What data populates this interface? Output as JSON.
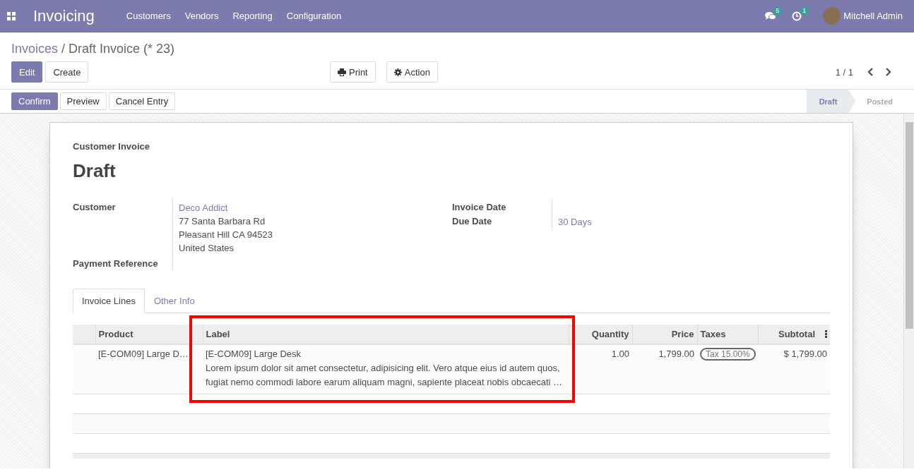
{
  "navbar": {
    "app_name": "Invoicing",
    "menu": [
      "Customers",
      "Vendors",
      "Reporting",
      "Configuration"
    ],
    "messages_count": "5",
    "activities_count": "1",
    "user": "Mitchell Admin"
  },
  "breadcrumb": {
    "parent": "Invoices",
    "separator": "/",
    "current": "Draft Invoice (* 23)"
  },
  "buttons": [
    {
      "label": "Edit",
      "primary": true
    },
    {
      "label": "Create",
      "primary": false
    }
  ],
  "actions": [
    {
      "label": "Print",
      "kind": "print"
    },
    {
      "label": "Action",
      "kind": "gear"
    }
  ],
  "pager": "1 / 1",
  "status_buttons": [
    {
      "label": "Confirm",
      "primary": true
    },
    {
      "label": "Preview",
      "primary": false
    },
    {
      "label": "Cancel Entry",
      "primary": false
    }
  ],
  "status_stages": [
    {
      "label": "Draft",
      "selected": true
    },
    {
      "label": "Posted",
      "selected": false
    }
  ],
  "sheet": {
    "subtitle": "Customer Invoice",
    "title": "Draft",
    "left_fields": [
      {
        "label": "Customer",
        "value": "Deco Addict",
        "address": [
          "77 Santa Barbara Rd",
          "Pleasant Hill CA 94523",
          "United States"
        ]
      },
      {
        "label": "Payment Reference"
      }
    ],
    "right_fields": [
      {
        "label": "Invoice Date"
      },
      {
        "label": "Due Date",
        "value": "30 Days"
      }
    ],
    "tabs": [
      {
        "label": "Invoice Lines",
        "selected": true
      },
      {
        "label": "Other Info",
        "selected": false
      }
    ],
    "table": {
      "columns": [
        {
          "label": "Product",
          "highlighted": false
        },
        {
          "label": "Label",
          "highlighted": true
        },
        {
          "label": "Quantity",
          "highlighted": false
        },
        {
          "label": "Price",
          "highlighted": false
        },
        {
          "label": "Taxes",
          "highlighted": false
        },
        {
          "label": "Subtotal",
          "highlighted": false
        }
      ],
      "rows": [
        {
          "product": "[E-COM09] Large D…",
          "label": "[E-COM09] Large Desk",
          "description": "Lorem ipsum dolor sit amet consectetur, adipisicing elit. Vero atque eius id autem quos, fugiat nemo commodi labore earum aliquam magni, sapiente placeat nobis obcaecati …",
          "quantity": "1.00",
          "price": "1,799.00",
          "taxes": [
            "Tax 15.00%"
          ],
          "subtotal": "$ 1,799.00"
        }
      ]
    }
  }
}
